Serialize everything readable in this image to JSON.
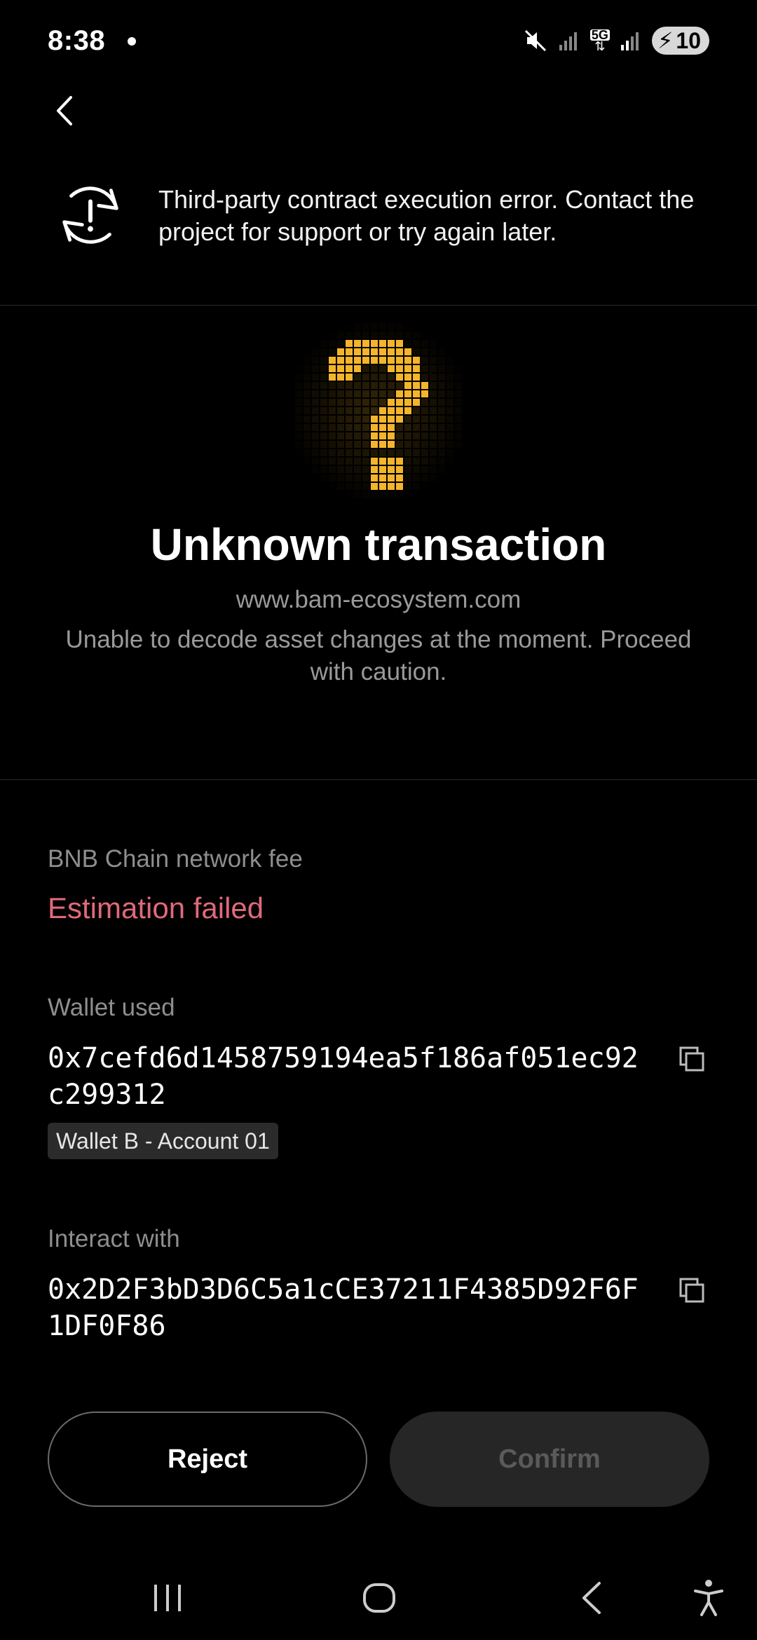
{
  "status_bar": {
    "time": "8:38",
    "network": "5G",
    "battery": "10"
  },
  "warning": {
    "message": "Third-party contract execution error. Contact the project for support or try again later."
  },
  "hero": {
    "icon": "question-mark-icon",
    "accent_color": "#f5b52a",
    "title": "Unknown transaction",
    "domain": "www.bam-ecosystem.com",
    "description": "Unable to decode asset changes at the moment. Proceed with caution."
  },
  "fee": {
    "label": "BNB Chain network fee",
    "status": "Estimation failed",
    "status_color": "#e06a7a"
  },
  "wallet": {
    "label": "Wallet used",
    "address": "0x7cefd6d1458759194ea5f186af051ec92c299312",
    "tag": "Wallet B - Account 01"
  },
  "interact": {
    "label": "Interact with",
    "address": "0x2D2F3bD3D6C5a1cCE37211F4385D92F6F1DF0F86"
  },
  "actions": {
    "reject_label": "Reject",
    "confirm_label": "Confirm"
  }
}
